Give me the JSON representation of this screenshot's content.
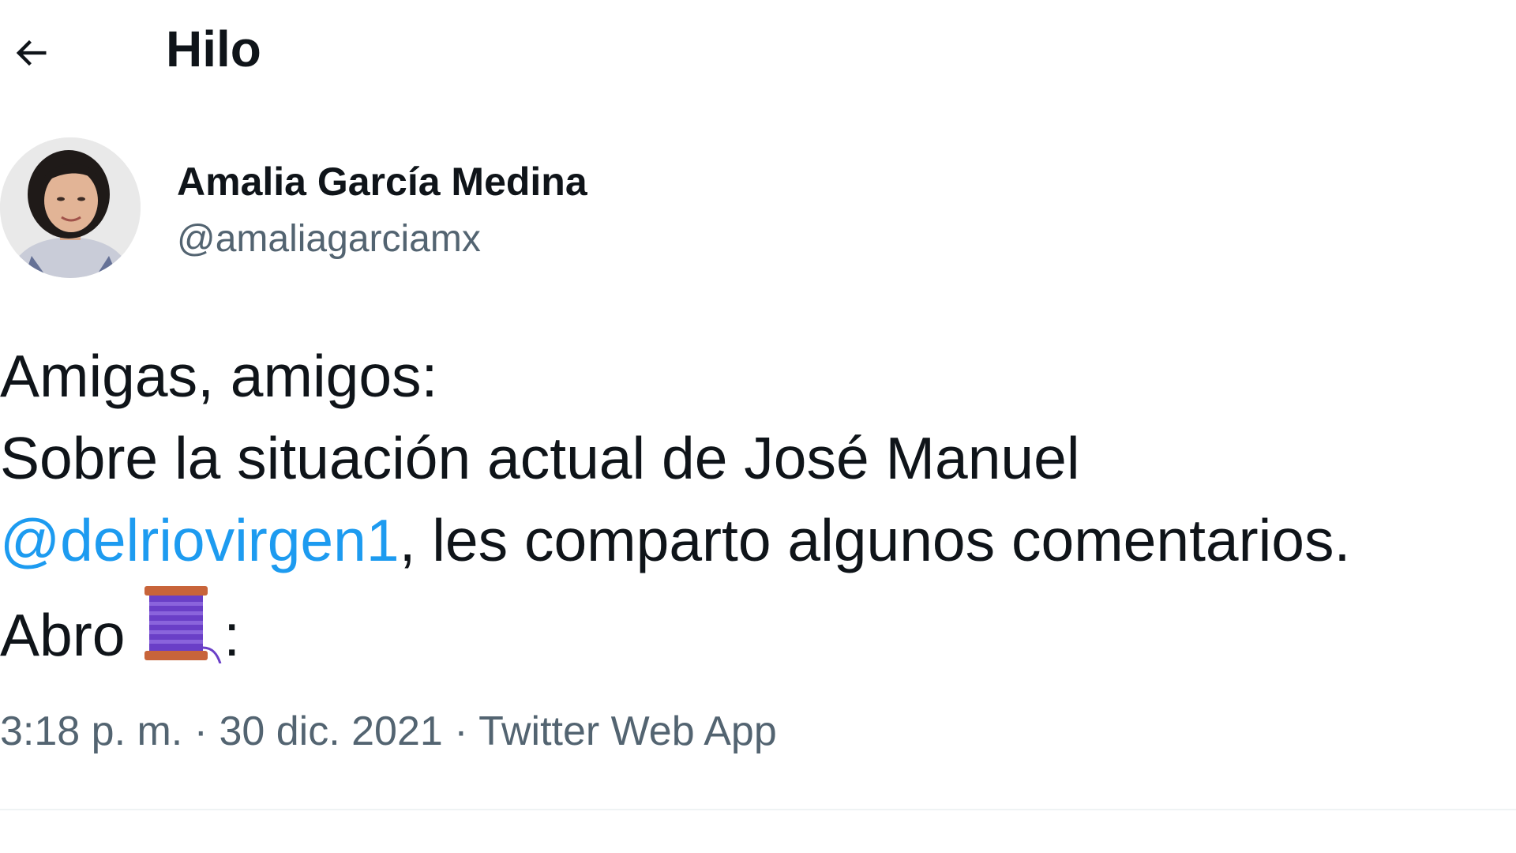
{
  "header": {
    "back_icon": "arrow-left-icon",
    "title": "Hilo"
  },
  "author": {
    "name": "Amalia García Medina",
    "handle": "@amaliagarciamx",
    "avatar_icon": "user-avatar"
  },
  "tweet": {
    "line1": "Amigas, amigos:",
    "line2": "Sobre la situación actual de José Manuel",
    "mention": "@delriovirgen1",
    "line3_rest": ", les comparto algunos comentarios.",
    "line4_start": "Abro ",
    "line4_end": ":",
    "emoji_icon": "thread-spool-icon"
  },
  "meta": {
    "time": "3:18 p. m.",
    "separator": " · ",
    "date": "30 dic. 2021",
    "source": "Twitter Web App"
  },
  "colors": {
    "text": "#0f1419",
    "secondary": "#536471",
    "link": "#1d9bf0",
    "divider": "#eff3f4"
  }
}
